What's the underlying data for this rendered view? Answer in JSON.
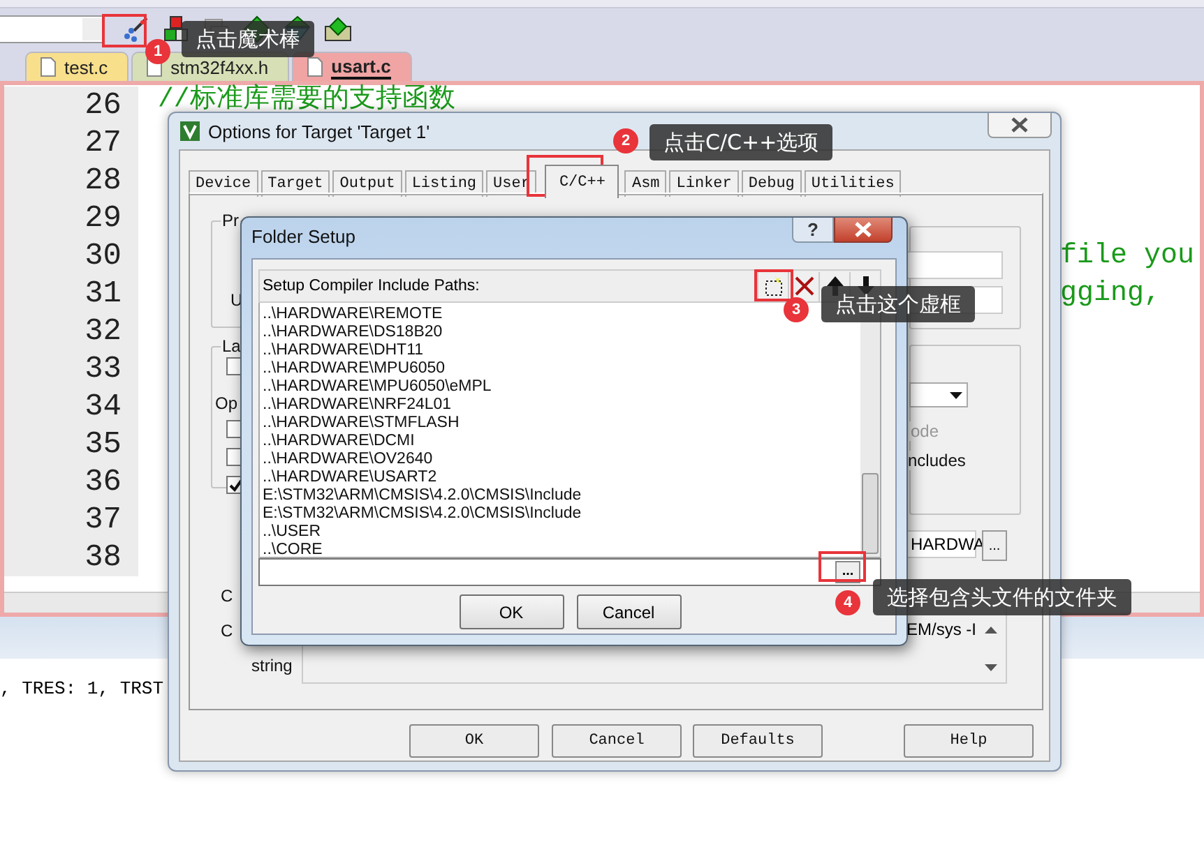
{
  "ide": {
    "editor_tabs": [
      {
        "label": "test.c",
        "selected": false,
        "color": "#f8df8c"
      },
      {
        "label": "stm32f4xx.h",
        "selected": false,
        "color": "#d6dfb6"
      },
      {
        "label": "usart.c",
        "selected": true,
        "color": "#f0a4a4"
      }
    ],
    "line_numbers": [
      "26",
      "27",
      "28",
      "29",
      "30",
      "31",
      "32",
      "33",
      "34",
      "35",
      "36",
      "37",
      "38"
    ],
    "code_lines": [
      "//标准库需要的支持函数"
    ],
    "code_fragments": [
      "file you",
      "gging,"
    ],
    "output_text": ", TRES: 1, TRST"
  },
  "options_dialog": {
    "title": "Options for Target 'Target 1'",
    "tabs": [
      {
        "label": "Device",
        "selected": false
      },
      {
        "label": "Target",
        "selected": false
      },
      {
        "label": "Output",
        "selected": false
      },
      {
        "label": "Listing",
        "selected": false
      },
      {
        "label": "User",
        "selected": false
      },
      {
        "label": "C/C++",
        "selected": true
      },
      {
        "label": "Asm",
        "selected": false
      },
      {
        "label": "Linker",
        "selected": false
      },
      {
        "label": "Debug",
        "selected": false
      },
      {
        "label": "Utilities",
        "selected": false
      }
    ],
    "preprocessor_label": "Pr",
    "undefine_label": "U",
    "language_label": "La",
    "options_label": "Op",
    "checkboxes": [
      {
        "checked": false
      },
      {
        "checked": false
      },
      {
        "checked": false
      },
      {
        "checked": true
      }
    ],
    "mode_label": "ode",
    "includes_label": "ncludes",
    "include_paths_value": "HARDWA",
    "browse_button": "...",
    "side_labels": [
      "C",
      "C"
    ],
    "string_label": "string",
    "string_value": "EM/sys -I",
    "buttons": [
      "OK",
      "Cancel",
      "Defaults",
      "Help"
    ]
  },
  "folder_dialog": {
    "title": "Folder Setup",
    "help_button": "?",
    "header": "Setup Compiler Include Paths:",
    "tools": [
      {
        "kind": "new"
      },
      {
        "kind": "delete"
      },
      {
        "kind": "up"
      },
      {
        "kind": "down"
      }
    ],
    "paths": [
      "..\\HARDWARE\\REMOTE",
      "..\\HARDWARE\\DS18B20",
      "..\\HARDWARE\\DHT11",
      "..\\HARDWARE\\MPU6050",
      "..\\HARDWARE\\MPU6050\\eMPL",
      "..\\HARDWARE\\NRF24L01",
      "..\\HARDWARE\\STMFLASH",
      "..\\HARDWARE\\DCMI",
      "..\\HARDWARE\\OV2640",
      "..\\HARDWARE\\USART2",
      "E:\\STM32\\ARM\\CMSIS\\4.2.0\\CMSIS\\Include",
      "E:\\STM32\\ARM\\CMSIS\\4.2.0\\CMSIS\\Include",
      "..\\USER",
      "..\\CORE"
    ],
    "browse_button": "...",
    "buttons": [
      "OK",
      "Cancel"
    ]
  },
  "annotations": [
    {
      "number": "1",
      "text": "点击魔术棒"
    },
    {
      "number": "2",
      "text": "点击C/C++选项"
    },
    {
      "number": "3",
      "text": "点击这个虚框"
    },
    {
      "number": "4",
      "text": "选择包含头文件的文件夹"
    }
  ]
}
